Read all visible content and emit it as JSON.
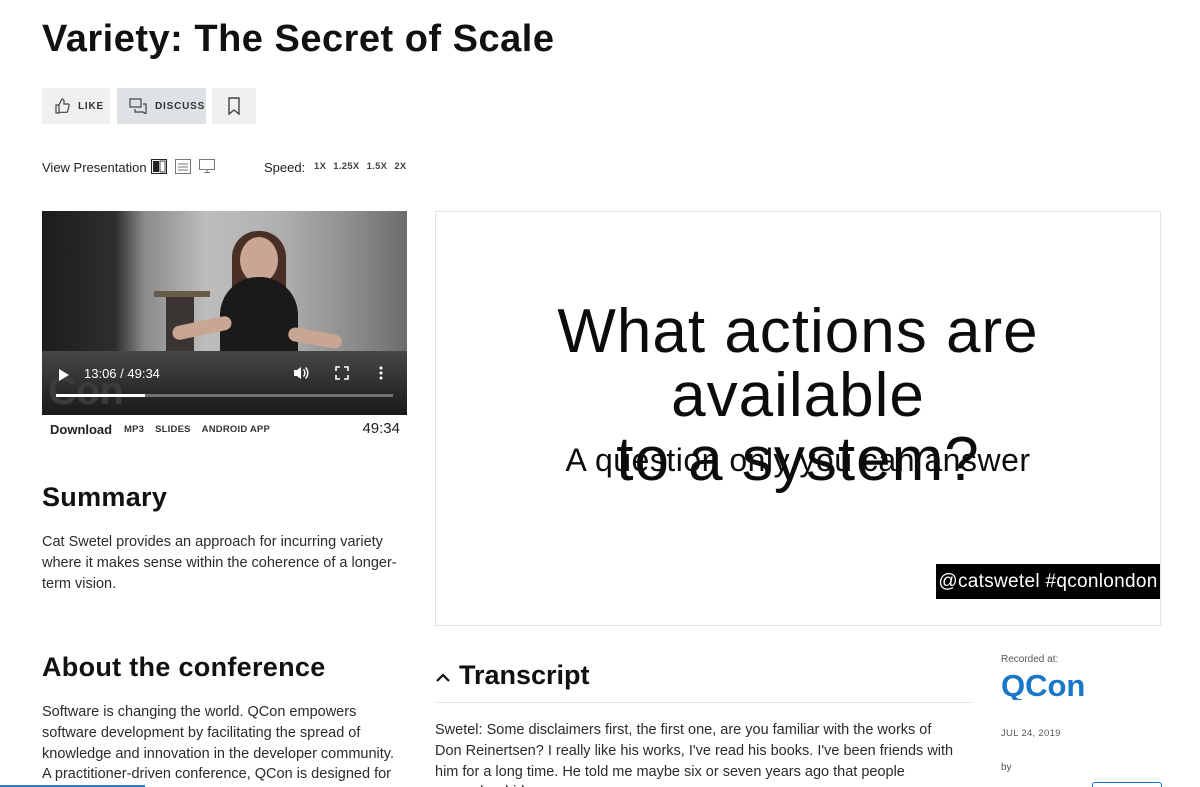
{
  "page": {
    "title": "Variety: The Secret of Scale"
  },
  "actions": {
    "like_label": "Like",
    "discuss_label": "Discuss",
    "bookmark_icon": "bookmark-icon"
  },
  "view": {
    "label": "View Presentation",
    "modes": [
      "split-view-icon",
      "horizontal-view-icon",
      "full-slides-icon"
    ]
  },
  "speed": {
    "label": "Speed:",
    "options": [
      "1X",
      "1.25X",
      "1.5X",
      "2X"
    ]
  },
  "video": {
    "time_display": "13:06 / 49:34",
    "progress": 0.264,
    "logo_fragment": "Con"
  },
  "downloads": {
    "label": "Download",
    "links": [
      "MP3",
      "SLIDES",
      "ANDROID APP"
    ],
    "duration": "49:34"
  },
  "slide": {
    "line1": "What actions are available",
    "line2": "to a system?",
    "subtitle": "A question only you can answer",
    "handle": "@catswetel #qconlondon"
  },
  "summary": {
    "heading": "Summary",
    "text": "Cat Swetel provides an approach for incurring variety where it makes sense within the coherence of a longer-term vision."
  },
  "about": {
    "heading": "About the conference",
    "text": "Software is changing the world. QCon empowers software development by facilitating the spread of knowledge and innovation in the developer community. A practitioner-driven conference, QCon is designed for technical team"
  },
  "transcript": {
    "heading": "Transcript",
    "text": "Swetel: Some disclaimers first, the first one, are you familiar with the works of Don Reinertsen? I really like his works, I've read his books. I've been friends with him for a long time. He told me maybe six or seven years ago that people remember hideous"
  },
  "meta": {
    "recorded_label": "Recorded at:",
    "event_logo": "QCon",
    "date": "JUL 24, 2019",
    "by_label": "by"
  },
  "colors": {
    "accent_blue": "#1a6fc4",
    "qcon_blue": "#1877c9"
  }
}
